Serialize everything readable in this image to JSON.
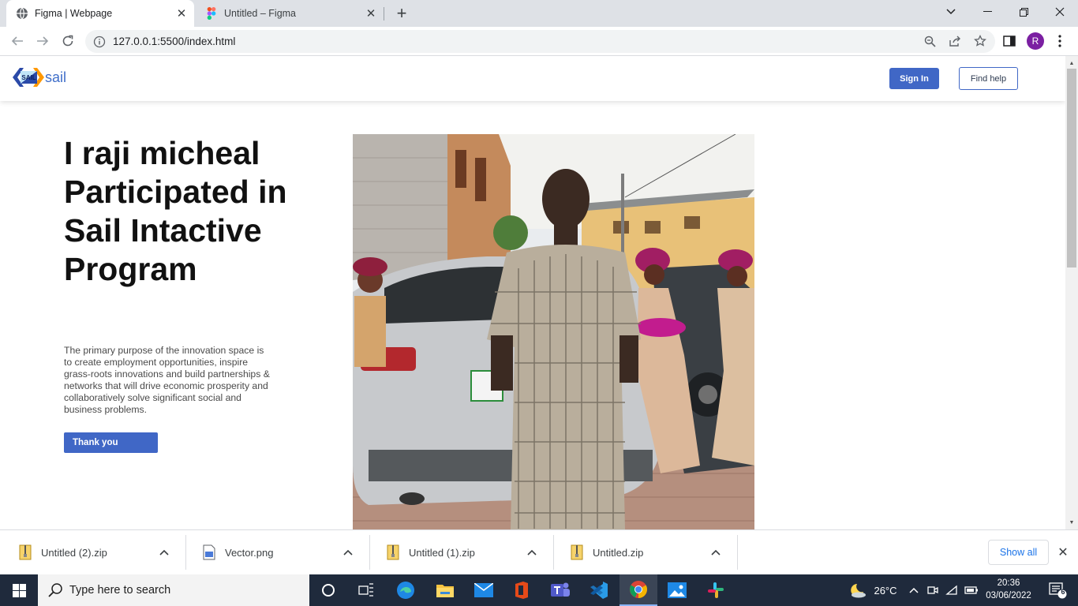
{
  "browser": {
    "tabs": [
      {
        "title": "Figma | Webpage",
        "favicon": "globe-icon",
        "active": true
      },
      {
        "title": "Untitled – Figma",
        "favicon": "figma-icon",
        "active": false
      }
    ],
    "url": "127.0.0.1:5500/index.html",
    "profile_initial": "R",
    "profile_color": "#7b1fa2"
  },
  "site": {
    "logo_mark_text": "SAIL",
    "logo_text": "sail",
    "header": {
      "signin_label": "Sign In",
      "help_label": "Find help"
    },
    "hero": {
      "title": "I raji micheal Participated in Sail Intactive Program",
      "description": "The primary purpose of the innovation space is to create employment opportunities, inspire grass-roots innovations and build partnerships & networks that will drive economic prosperity and collaboratively solve significant social and business problems.",
      "button_label": "Thank you"
    },
    "accent_color": "#4067c6"
  },
  "downloads": {
    "items": [
      {
        "name": "Untitled (2).zip",
        "icon": "zip-file-icon"
      },
      {
        "name": "Vector.png",
        "icon": "image-file-icon"
      },
      {
        "name": "Untitled (1).zip",
        "icon": "zip-file-icon"
      },
      {
        "name": "Untitled.zip",
        "icon": "zip-file-icon"
      }
    ],
    "show_all_label": "Show all"
  },
  "taskbar": {
    "search_placeholder": "Type here to search",
    "weather": "26°C",
    "time": "20:36",
    "date": "03/06/2022",
    "notification_count": "6"
  }
}
